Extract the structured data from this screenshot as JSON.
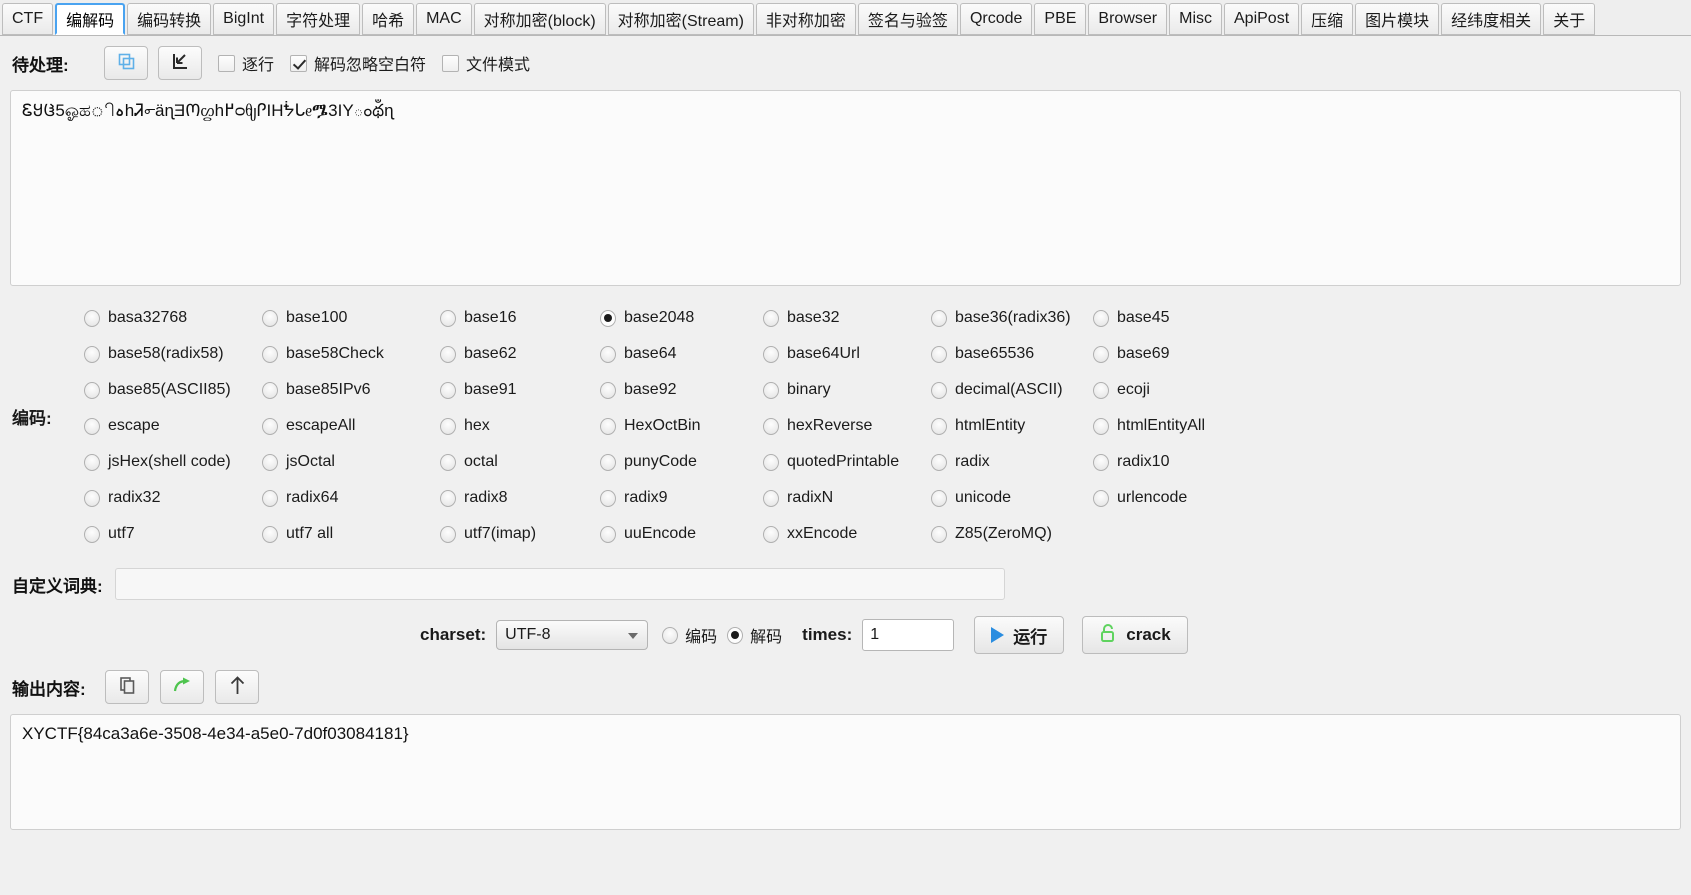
{
  "tabs": [
    {
      "label": "CTF",
      "active": false
    },
    {
      "label": "编解码",
      "active": true
    },
    {
      "label": "编码转换",
      "active": false
    },
    {
      "label": "BigInt",
      "active": false
    },
    {
      "label": "字符处理",
      "active": false
    },
    {
      "label": "哈希",
      "active": false
    },
    {
      "label": "MAC",
      "active": false
    },
    {
      "label": "对称加密(block)",
      "active": false
    },
    {
      "label": "对称加密(Stream)",
      "active": false
    },
    {
      "label": "非对称加密",
      "active": false
    },
    {
      "label": "签名与验签",
      "active": false
    },
    {
      "label": "Qrcode",
      "active": false
    },
    {
      "label": "PBE",
      "active": false
    },
    {
      "label": "Browser",
      "active": false
    },
    {
      "label": "Misc",
      "active": false
    },
    {
      "label": "ApiPost",
      "active": false
    },
    {
      "label": "压缩",
      "active": false
    },
    {
      "label": "图片模块",
      "active": false
    },
    {
      "label": "经纬度相关",
      "active": false
    },
    {
      "label": "关于",
      "active": false
    }
  ],
  "input_section": {
    "label": "待处理:",
    "copy_icon": "copy-icon",
    "import_icon": "import-arrow-icon",
    "checkboxes": [
      {
        "label": "逐行",
        "checked": false
      },
      {
        "label": "解码忽略空白符",
        "checked": true
      },
      {
        "label": "文件模式",
        "checked": false
      }
    ],
    "text": "ᏋᲧᲱ5ஓಹிہhᏘ൳ä​ɳƎᲝᦛh߂ᴑᧀᎵIHᖭᒐᧉᎂ3IYంథఀɳ"
  },
  "encoding_section": {
    "label": "编码:",
    "selected": "base2048",
    "options": [
      "basa32768",
      "base100",
      "base16",
      "base2048",
      "base32",
      "base36(radix36)",
      "base45",
      "base58(radix58)",
      "base58Check",
      "base62",
      "base64",
      "base64Url",
      "base65536",
      "base69",
      "base85(ASCII85)",
      "base85IPv6",
      "base91",
      "base92",
      "binary",
      "decimal(ASCII)",
      "ecoji",
      "escape",
      "escapeAll",
      "hex",
      "HexOctBin",
      "hexReverse",
      "htmlEntity",
      "htmlEntityAll",
      "jsHex(shell code)",
      "jsOctal",
      "octal",
      "punyCode",
      "quotedPrintable",
      "radix",
      "radix10",
      "radix32",
      "radix64",
      "radix8",
      "radix9",
      "radixN",
      "unicode",
      "urlencode",
      "utf7",
      "utf7 all",
      "utf7(imap)",
      "uuEncode",
      "xxEncode",
      "Z85(ZeroMQ)"
    ]
  },
  "dict_section": {
    "label": "自定义词典:",
    "value": "",
    "placeholder": ""
  },
  "controls": {
    "charset_label": "charset:",
    "charset_value": "UTF-8",
    "mode_encode": {
      "label": "编码",
      "selected": false
    },
    "mode_decode": {
      "label": "解码",
      "selected": true
    },
    "times_label": "times:",
    "times_value": "1",
    "run_button": "运行",
    "crack_button": "crack",
    "run_icon": "play-icon",
    "crack_icon": "unlock-icon"
  },
  "output_section": {
    "label": "输出内容:",
    "copy_icon": "copy-icon",
    "send_icon": "forward-arrow-icon",
    "up_icon": "up-arrow-icon",
    "text": "XYCTF{84ca3a6e-3508-4e34-a5e0-7d0f03084181}"
  },
  "colors": {
    "accent": "#4aa3f0",
    "play": "#2a8de0",
    "crack": "#5fd35f"
  }
}
